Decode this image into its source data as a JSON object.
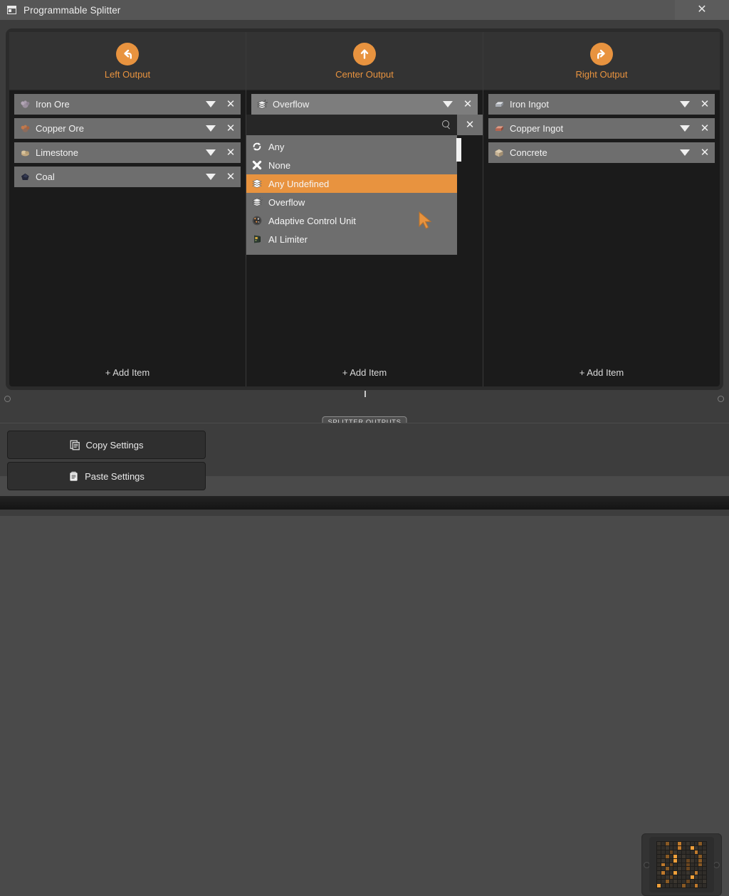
{
  "window": {
    "title": "Programmable Splitter",
    "icon": "window-icon",
    "close_label": "✕"
  },
  "panel": {
    "section_label": "SPLITTER OUTPUTS",
    "accent_color": "#e8933f",
    "row_color": "#6e6e6e",
    "background": "#1b1b1b"
  },
  "columns": [
    {
      "id": "left",
      "header_label": "Left Output",
      "header_icon": "arrow-turn-left-icon",
      "add_item_label": "+ Add Item",
      "items": [
        {
          "name": "Iron Ore",
          "icon": "iron-ore-icon",
          "color": "#9b8f9e",
          "caret": "▼",
          "remove": "✕"
        },
        {
          "name": "Copper Ore",
          "icon": "copper-ore-icon",
          "color": "#b5764b",
          "caret": "▼",
          "remove": "✕"
        },
        {
          "name": "Limestone",
          "icon": "limestone-icon",
          "color": "#cdb48f",
          "caret": "▼",
          "remove": "✕"
        },
        {
          "name": "Coal",
          "icon": "coal-icon",
          "color": "#2a2d3c",
          "caret": "▼",
          "remove": "✕"
        }
      ]
    },
    {
      "id": "center",
      "header_label": "Center Output",
      "header_icon": "arrow-up-icon",
      "add_item_label": "+ Add Item",
      "items": [
        {
          "name": "Overflow",
          "icon": "overflow-icon",
          "color": "#c9c9c9",
          "caret": "▼",
          "remove": "✕"
        }
      ],
      "dropdown": {
        "open": true,
        "search_value": "",
        "search_placeholder": "",
        "search_icon": "search-icon",
        "clear_label": "✕",
        "options": [
          {
            "label": "Any",
            "icon": "any-recycle-icon",
            "selected": false
          },
          {
            "label": "None",
            "icon": "none-cross-icon",
            "selected": false
          },
          {
            "label": "Any Undefined",
            "icon": "any-undefined-layers-icon",
            "selected": true
          },
          {
            "label": "Overflow",
            "icon": "overflow-icon",
            "selected": false
          },
          {
            "label": "Adaptive Control Unit",
            "icon": "adaptive-control-unit-icon",
            "selected": false
          },
          {
            "label": "AI Limiter",
            "icon": "ai-limiter-icon",
            "selected": false
          }
        ]
      }
    },
    {
      "id": "right",
      "header_label": "Right Output",
      "header_icon": "arrow-turn-right-icon",
      "add_item_label": "+ Add Item",
      "items": [
        {
          "name": "Iron Ingot",
          "icon": "iron-ingot-icon",
          "color": "#c3c6cb",
          "caret": "▼",
          "remove": "✕"
        },
        {
          "name": "Copper Ingot",
          "icon": "copper-ingot-icon",
          "color": "#c9745e",
          "caret": "▼",
          "remove": "✕"
        },
        {
          "name": "Concrete",
          "icon": "concrete-icon",
          "color": "#cbb796",
          "caret": "▼",
          "remove": "✕"
        }
      ]
    }
  ],
  "footer": {
    "copy_label": "Copy Settings",
    "copy_icon": "copy-icon",
    "paste_label": "Paste Settings",
    "paste_icon": "clipboard-icon",
    "module_icon": "led-matrix-panel"
  }
}
